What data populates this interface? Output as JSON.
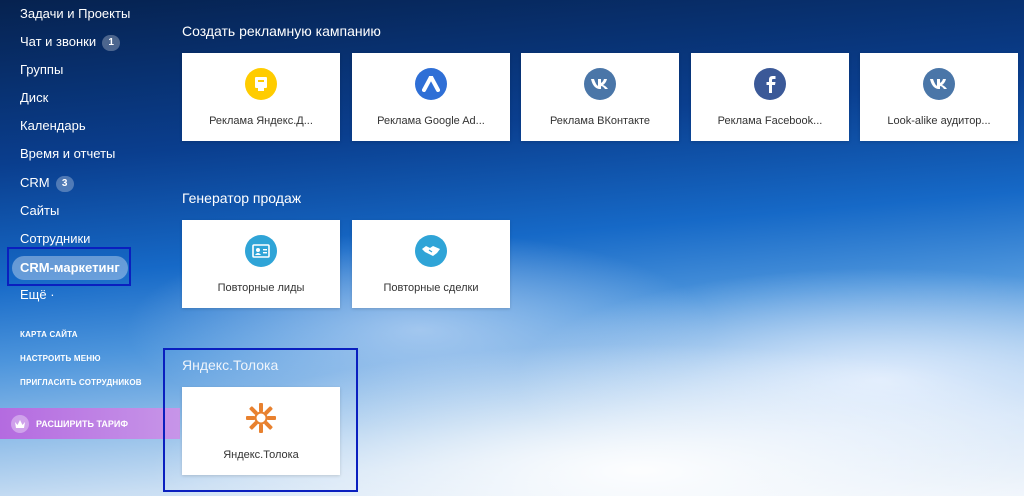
{
  "sidebar": {
    "items": [
      {
        "label": "Задачи и Проекты"
      },
      {
        "label": "Чат и звонки",
        "badge": "1"
      },
      {
        "label": "Группы"
      },
      {
        "label": "Диск"
      },
      {
        "label": "Календарь"
      },
      {
        "label": "Время и отчеты"
      },
      {
        "label": "CRM",
        "badge": "3"
      },
      {
        "label": "Сайты"
      },
      {
        "label": "Сотрудники"
      },
      {
        "label": "CRM-маркетинг"
      },
      {
        "label": "Ещё ·"
      }
    ],
    "links": [
      {
        "label": "КАРТА САЙТА"
      },
      {
        "label": "НАСТРОИТЬ МЕНЮ"
      },
      {
        "label": "ПРИГЛАСИТЬ СОТРУДНИКОВ"
      }
    ],
    "upgrade": {
      "label": "РАСШИРИТЬ ТАРИФ",
      "icon": "crown-icon"
    }
  },
  "sections": [
    {
      "title": "Создать рекламную кампанию",
      "tiles": [
        {
          "label": "Реклама Яндекс.Д...",
          "icon": "yandex-direct-icon",
          "color": "#ffcc00"
        },
        {
          "label": "Реклама Google Ad...",
          "icon": "google-ads-icon",
          "color": "#2f6fd6"
        },
        {
          "label": "Реклама ВКонтакте",
          "icon": "vk-icon",
          "color": "#4a76a8"
        },
        {
          "label": "Реклама Facebook...",
          "icon": "facebook-icon",
          "color": "#3b5998"
        },
        {
          "label": "Look-alike аудитор...",
          "icon": "vk-icon",
          "color": "#4a76a8"
        }
      ]
    },
    {
      "title": "Генератор продаж",
      "tiles": [
        {
          "label": "Повторные лиды",
          "icon": "contact-card-icon",
          "color": "#2fa4d7"
        },
        {
          "label": "Повторные сделки",
          "icon": "handshake-icon",
          "color": "#2fa4d7"
        }
      ]
    },
    {
      "title": "Яндекс.Толока",
      "tiles": [
        {
          "label": "Яндекс.Толока",
          "icon": "toloka-icon",
          "color": "#e8812f"
        }
      ]
    }
  ]
}
